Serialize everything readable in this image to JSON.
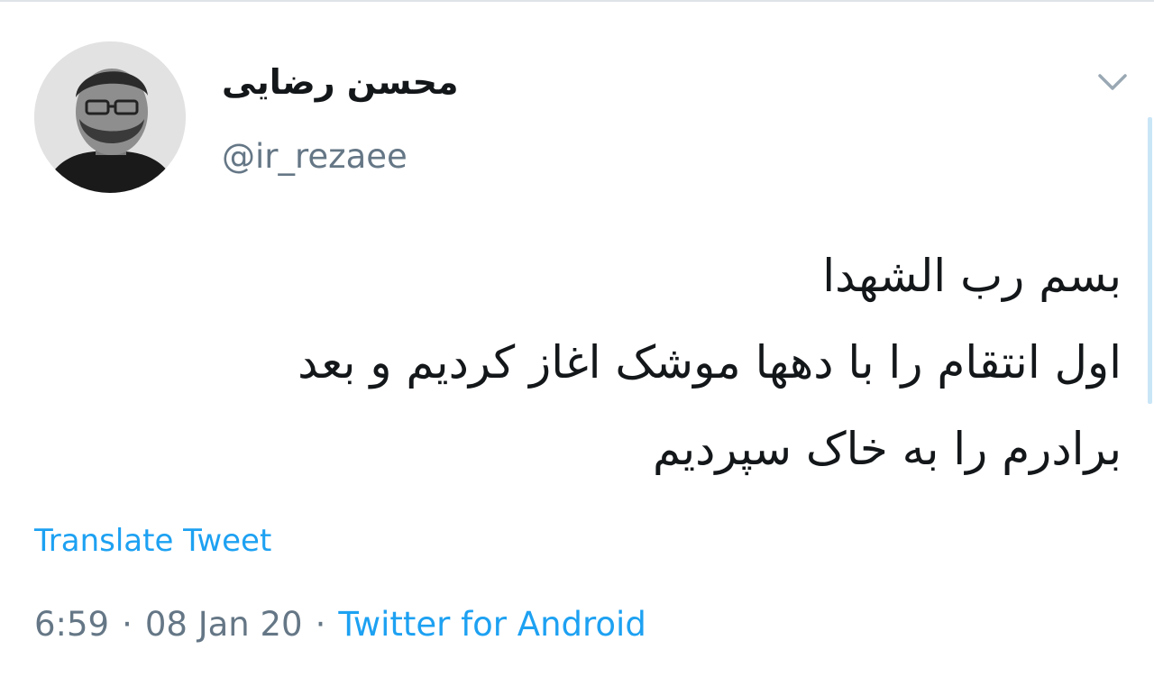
{
  "tweet": {
    "display_name": "محسن رضایی",
    "handle": "@ir_rezaee",
    "text_lines": [
      "بسم رب الشهدا",
      "اول انتقام را با دهها موشک اغاز کردیم و بعد",
      "برادرم را به خاک سپردیم"
    ],
    "translate_label": "Translate Tweet",
    "time": "6:59",
    "date": "08 Jan 20",
    "separator": "·",
    "source": "Twitter for Android"
  },
  "icons": {
    "more": "chevron-down-icon",
    "avatar": "avatar-photo"
  },
  "colors": {
    "text": "#14171a",
    "secondary": "#657786",
    "link": "#1da1f2"
  }
}
